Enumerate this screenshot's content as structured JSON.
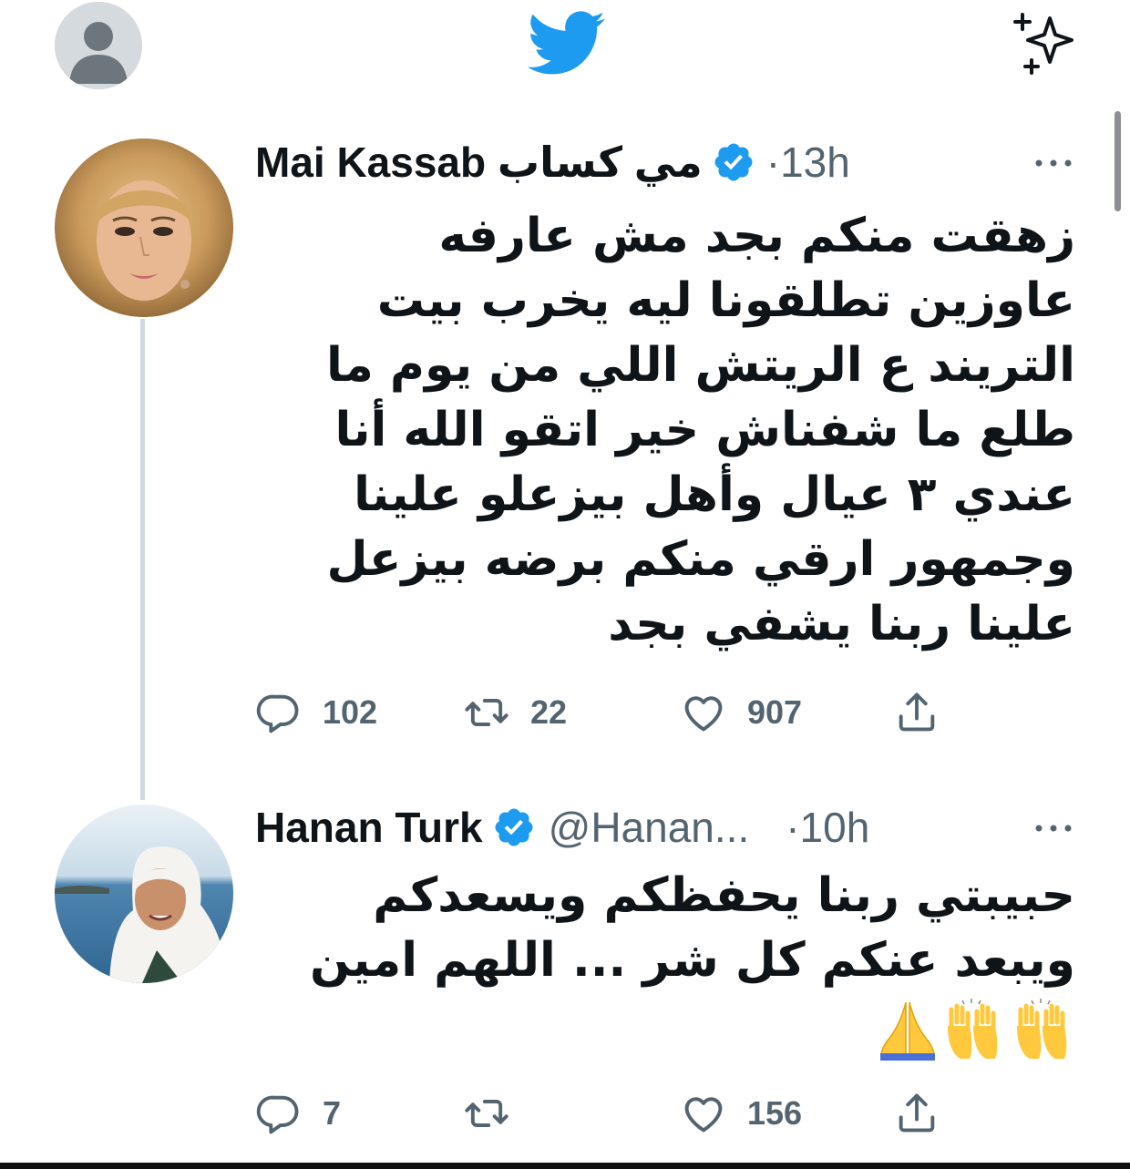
{
  "colors": {
    "twitter_blue": "#1d9bf0",
    "text_primary": "#0f1419",
    "text_secondary": "#536471",
    "thread_line": "#cfd9de"
  },
  "topbar": {
    "logo_icon": "twitter-bird-icon",
    "right_icon": "sparkle-icon",
    "left_icon": "default-avatar-icon"
  },
  "tweets": [
    {
      "name": "Mai Kassab مي كساب",
      "verified": true,
      "handle": "",
      "time": "·13h",
      "text": "زهقت منكم بجد مش عارفه عاوزين تطلقونا ليه يخرب بيت التريند ع الريتش اللي من يوم ما طلع ما شفناش خير اتقو الله أنا عندي ٣ عيال وأهل بيزعلو علينا وجمهور ارقي منكم برضه بيزعل علينا ربنا يشفي بجد",
      "replies": "102",
      "retweets": "22",
      "likes": "907"
    },
    {
      "name": "Hanan Turk",
      "verified": true,
      "handle": "@Hanan...",
      "time": "·10h",
      "text": "حبيبتي ربنا يحفظكم ويسعدكم ويبعد عنكم كل شر ... اللهم امين",
      "emojis": "🙏🙌🙌🙌",
      "replies": "7",
      "retweets": "",
      "likes": "156"
    }
  ]
}
